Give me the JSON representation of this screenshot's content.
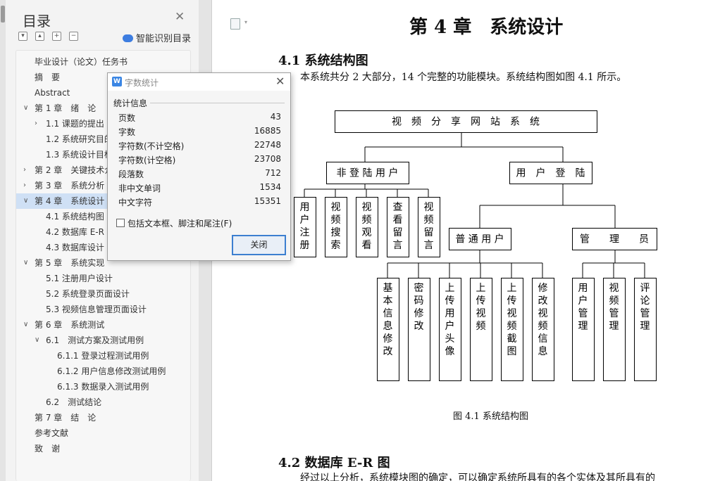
{
  "toc": {
    "title": "目录",
    "smart_label": "智能识别目录",
    "items": [
      {
        "label": "毕业设计（论文）任务书",
        "level": 0
      },
      {
        "label": "摘　要",
        "level": 0
      },
      {
        "label": "Abstract",
        "level": 0
      },
      {
        "label": "第 1 章　绪　论",
        "level": 0,
        "arrow": "expanded"
      },
      {
        "label": "1.1 课题的提出",
        "level": 1,
        "arrow": "collapsed"
      },
      {
        "label": "1.2 系统研究目的",
        "level": 1
      },
      {
        "label": "1.3 系统设计目标",
        "level": 1
      },
      {
        "label": "第 2 章　关键技术介绍",
        "level": 0,
        "arrow": "collapsed"
      },
      {
        "label": "第 3 章　系统分析",
        "level": 0,
        "arrow": "collapsed"
      },
      {
        "label": "第 4 章　系统设计",
        "level": 0,
        "arrow": "expanded",
        "selected": true
      },
      {
        "label": "4.1 系统结构图",
        "level": 1
      },
      {
        "label": "4.2 数据库 E-R 图",
        "level": 1
      },
      {
        "label": "4.3 数据库设计",
        "level": 1
      },
      {
        "label": "第 5 章　系统实现",
        "level": 0,
        "arrow": "expanded"
      },
      {
        "label": "5.1 注册用户设计",
        "level": 1
      },
      {
        "label": "5.2 系统登录页面设计",
        "level": 1
      },
      {
        "label": "5.3 视频信息管理页面设计",
        "level": 1
      },
      {
        "label": "第 6 章　系统测试",
        "level": 0,
        "arrow": "expanded"
      },
      {
        "label": "6.1　测试方案及测试用例",
        "level": 1,
        "arrow": "expanded"
      },
      {
        "label": "6.1.1 登录过程测试用例",
        "level": 2
      },
      {
        "label": "6.1.2 用户信息修改测试用例",
        "level": 2
      },
      {
        "label": "6.1.3 数据录入测试用例",
        "level": 2
      },
      {
        "label": "6.2　测试结论",
        "level": 1
      },
      {
        "label": "第 7 章　结　论",
        "level": 0
      },
      {
        "label": "参考文献",
        "level": 0
      },
      {
        "label": "致　谢",
        "level": 0
      }
    ]
  },
  "document": {
    "chapter_title": "第 4 章　系统设计",
    "sec41_title": "4.1  系统结构图",
    "para1": "本系统共分 2 大部分，14 个完整的功能模块。系统结构图如图 4.1 所示。",
    "figure_caption": "图 4.1 系统结构图",
    "sec42_title": "4.2  数据库 E-R 图",
    "para2": "经过以上分析，系统模块图的确定，可以确定系统所具有的各个实体及其所具有的"
  },
  "diagram": {
    "root": "视　频　分　享　网　站　系　统",
    "nonlogin": "非 登 陆 用 户",
    "nonlogin_children": [
      "用户注册",
      "视频搜索",
      "视频观看",
      "查看留言",
      "视频留言"
    ],
    "login": "用　户　登　陆",
    "normal": "普 通 用 户",
    "normal_children": [
      "基本信息修改",
      "密码修改",
      "上传用户头像",
      "上传视频",
      "上传视频截图",
      "修改视频信息"
    ],
    "admin": "管　　理　　员",
    "admin_children": [
      "用户管理",
      "视频管理",
      "评论管理"
    ]
  },
  "dialog": {
    "title": "字数统计",
    "group_label": "统计信息",
    "stats": [
      {
        "label": "页数",
        "value": "43"
      },
      {
        "label": "字数",
        "value": "16885"
      },
      {
        "label": "字符数(不计空格)",
        "value": "22748"
      },
      {
        "label": "字符数(计空格)",
        "value": "23708"
      },
      {
        "label": "段落数",
        "value": "712"
      },
      {
        "label": "非中文单词",
        "value": "1534"
      },
      {
        "label": "中文字符",
        "value": "15351"
      }
    ],
    "checkbox_label": "包括文本框、脚注和尾注(F)",
    "checkbox_checked": false,
    "close_button": "关闭"
  }
}
